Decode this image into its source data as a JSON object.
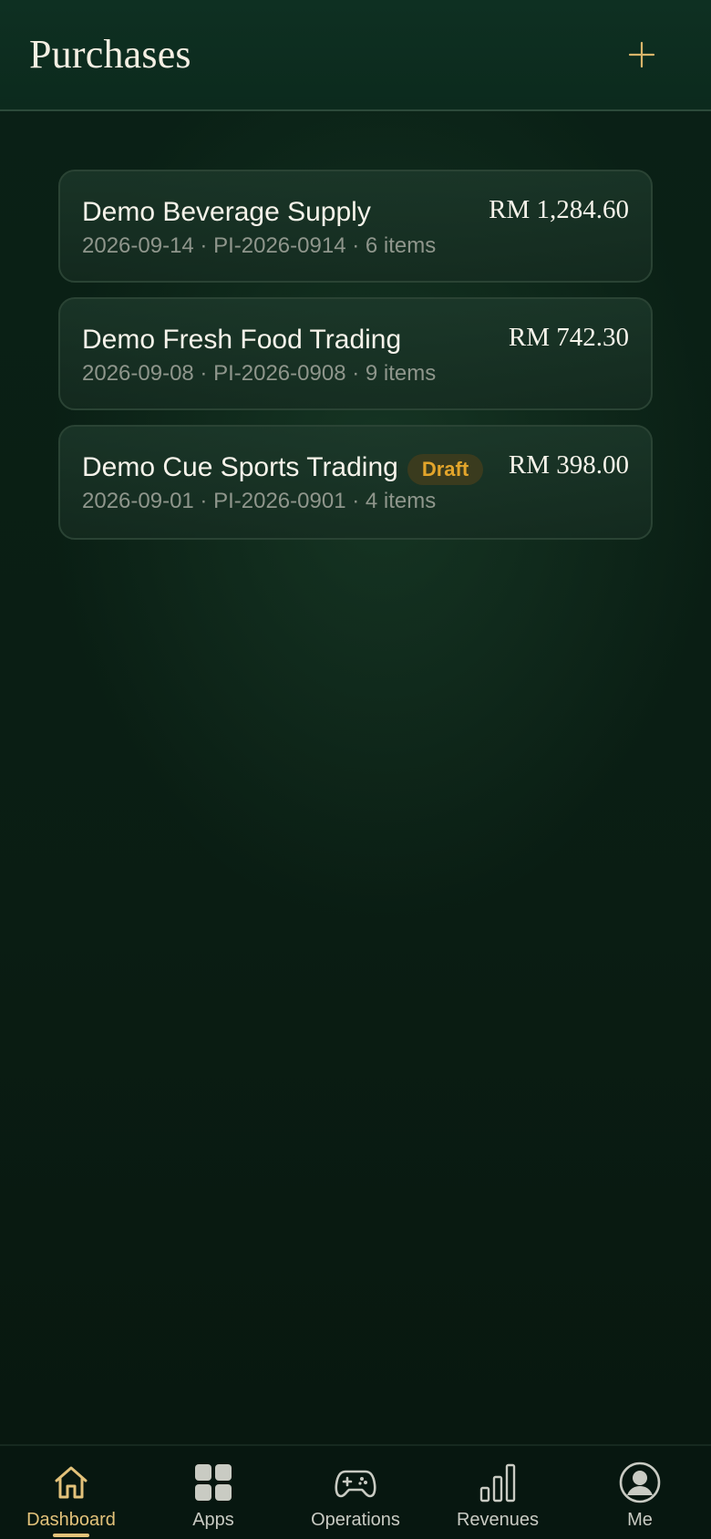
{
  "header": {
    "title": "Purchases",
    "add_icon": "plus-icon"
  },
  "purchases": [
    {
      "supplier": "Demo Beverage Supply",
      "amount": "RM 1,284.60",
      "meta": "2026-09-14 · PI-2026-0914 · 6 items",
      "status": ""
    },
    {
      "supplier": "Demo Fresh Food Trading",
      "amount": "RM 742.30",
      "meta": "2026-09-08 · PI-2026-0908 · 9 items",
      "status": ""
    },
    {
      "supplier": "Demo Cue Sports Trading",
      "amount": "RM 398.00",
      "meta": "2026-09-01 · PI-2026-0901 · 4 items",
      "status": "Draft"
    }
  ],
  "nav": {
    "items": [
      {
        "label": "Dashboard",
        "icon": "home-icon",
        "active": true
      },
      {
        "label": "Apps",
        "icon": "grid-icon",
        "active": false
      },
      {
        "label": "Operations",
        "icon": "gamepad-icon",
        "active": false
      },
      {
        "label": "Revenues",
        "icon": "bar-chart-icon",
        "active": false
      },
      {
        "label": "Me",
        "icon": "user-circle-icon",
        "active": false
      }
    ]
  },
  "colors": {
    "accent_gold": "#e3c27a",
    "draft_badge_text": "#e3a52b",
    "background": "#0a1d13"
  }
}
